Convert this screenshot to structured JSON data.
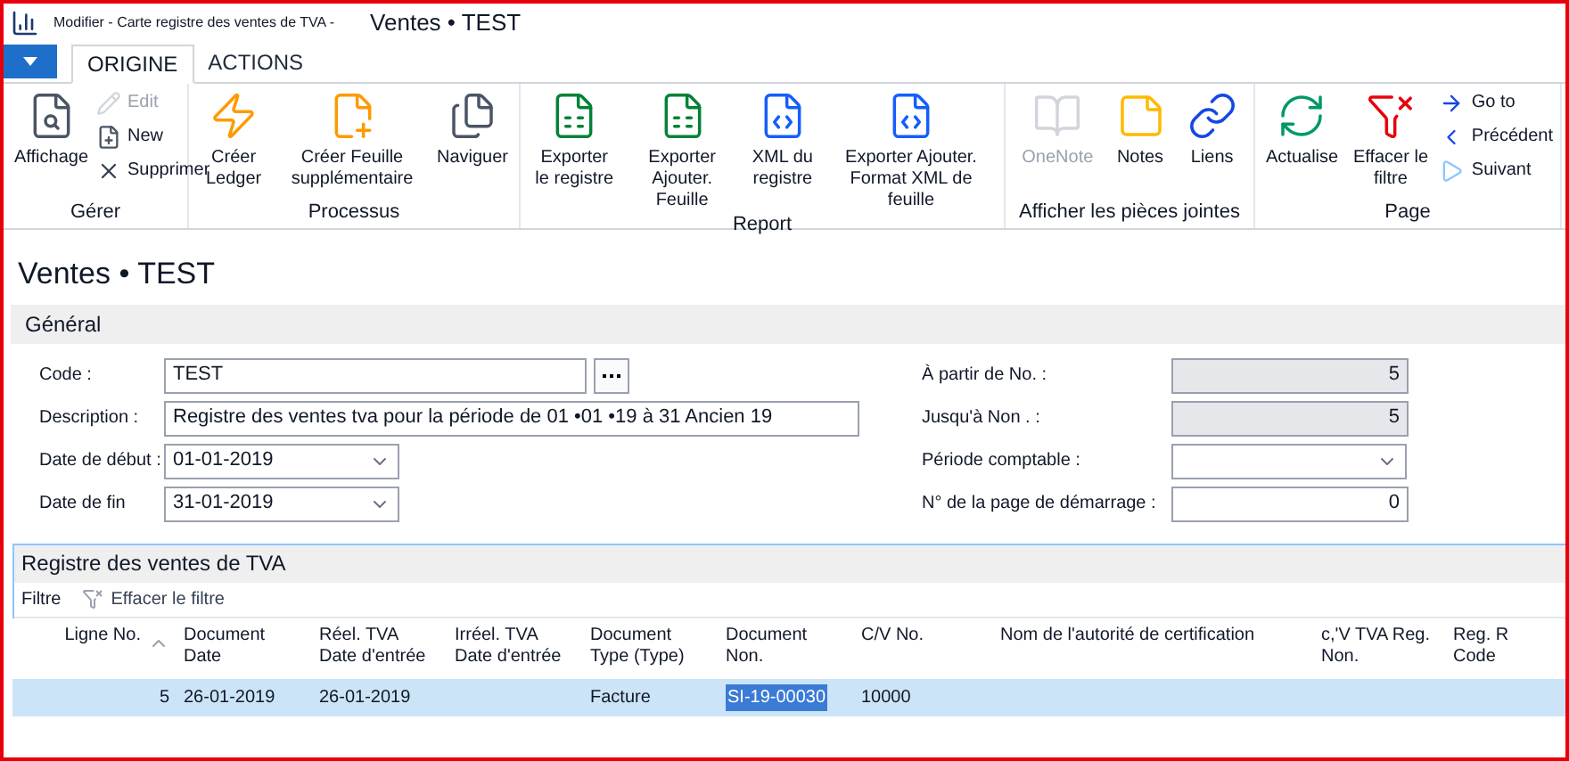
{
  "window": {
    "caption": "Modifier - Carte registre des ventes de TVA -",
    "title": "Ventes • TEST"
  },
  "tabs": [
    {
      "label": "ORIGINE",
      "selected": true
    },
    {
      "label": "ACTIONS",
      "selected": false
    }
  ],
  "ribbon": [
    {
      "label": "Gérer",
      "buttons": [
        {
          "label": "Affichage",
          "kind": "large",
          "disabled": false
        },
        {
          "label": "Edit",
          "kind": "small",
          "disabled": true
        },
        {
          "label": "New",
          "kind": "small",
          "disabled": false
        },
        {
          "label": "Supprimer",
          "kind": "small",
          "disabled": false
        }
      ]
    },
    {
      "label": "Processus",
      "buttons": [
        {
          "label": "Créer Ledger",
          "kind": "large",
          "disabled": false
        },
        {
          "label": "Créer Feuille supplémentaire",
          "kind": "large",
          "disabled": false
        },
        {
          "label": "Naviguer",
          "kind": "large",
          "disabled": false
        }
      ]
    },
    {
      "label": "Report",
      "buttons": [
        {
          "label": "Exporter le registre",
          "kind": "large",
          "disabled": false
        },
        {
          "label": "Exporter Ajouter. Feuille",
          "kind": "large",
          "disabled": false
        },
        {
          "label": "XML du registre",
          "kind": "large",
          "disabled": false
        },
        {
          "label": "Exporter Ajouter. Format XML de feuille",
          "kind": "large",
          "disabled": false
        }
      ]
    },
    {
      "label": "Afficher les pièces jointes",
      "buttons": [
        {
          "label": "OneNote",
          "kind": "large",
          "disabled": true
        },
        {
          "label": "Notes",
          "kind": "large",
          "disabled": false
        },
        {
          "label": "Liens",
          "kind": "large",
          "disabled": false
        }
      ]
    },
    {
      "label": "Page",
      "buttons": [
        {
          "label": "Actualise",
          "kind": "large",
          "disabled": false
        },
        {
          "label": "Effacer le filtre",
          "kind": "large",
          "disabled": false
        },
        {
          "label": "Go to",
          "kind": "small",
          "disabled": false
        },
        {
          "label": "Précédent",
          "kind": "small",
          "disabled": false
        },
        {
          "label": "Suivant",
          "kind": "small",
          "disabled": false
        }
      ]
    }
  ],
  "page_title": "Ventes • TEST",
  "general": {
    "title": "Général",
    "left": [
      {
        "label": "Code :",
        "value": "TEST",
        "kind": "lookup"
      },
      {
        "label": "Description :",
        "value": "Registre des ventes tva pour la période de 01 •01 •19 à 31 Ancien 19",
        "kind": "text"
      },
      {
        "label": "Date de début :",
        "value": "01-01-2019",
        "kind": "dropdown"
      },
      {
        "label": "Date de fin",
        "value": "31-01-2019",
        "kind": "dropdown"
      }
    ],
    "right": [
      {
        "label": "À partir de No. :",
        "value": "5",
        "kind": "readonly"
      },
      {
        "label": "Jusqu'à Non . :",
        "value": "5",
        "kind": "readonly"
      },
      {
        "label": "Période comptable :",
        "kind": "dropdown"
      },
      {
        "label": "N° de la page de démarrage :",
        "value": "0",
        "kind": "number"
      }
    ]
  },
  "lines": {
    "title": "Registre des ventes de TVA",
    "toolbar": [
      {
        "label": "Filtre",
        "disabled": false
      },
      {
        "label": "Effacer le filtre",
        "disabled": true
      }
    ],
    "columns": [
      {
        "lines": [
          "Ligne No."
        ],
        "sorted": true
      },
      {
        "lines": [
          "Document",
          "Date"
        ],
        "sorted": false
      },
      {
        "lines": [
          "Réel. TVA",
          "Date d'entrée"
        ],
        "sorted": false
      },
      {
        "lines": [
          "Irréel. TVA",
          "Date d'entrée"
        ],
        "sorted": false
      },
      {
        "lines": [
          "Document",
          "Type (Type)"
        ],
        "sorted": false
      },
      {
        "lines": [
          "Document",
          "Non."
        ],
        "sorted": false
      },
      {
        "lines": [
          "C/V No."
        ],
        "sorted": false
      },
      {
        "lines": [
          "Nom de l'autorité de certification"
        ],
        "sorted": false
      },
      {
        "lines": [
          "c,'V TVA Reg.",
          "Non."
        ],
        "sorted": false
      },
      {
        "lines": [
          "Reg. R",
          "Code"
        ],
        "sorted": false
      }
    ],
    "rows": [
      {
        "selected": true,
        "line_no": "5",
        "document_date": "26-01-2019",
        "real_vat_entry_date": "26-01-2019",
        "document_type": "Facture",
        "document_no": "SI-19-00030",
        "document_no_selected": true,
        "cv_no": "10000"
      }
    ]
  }
}
